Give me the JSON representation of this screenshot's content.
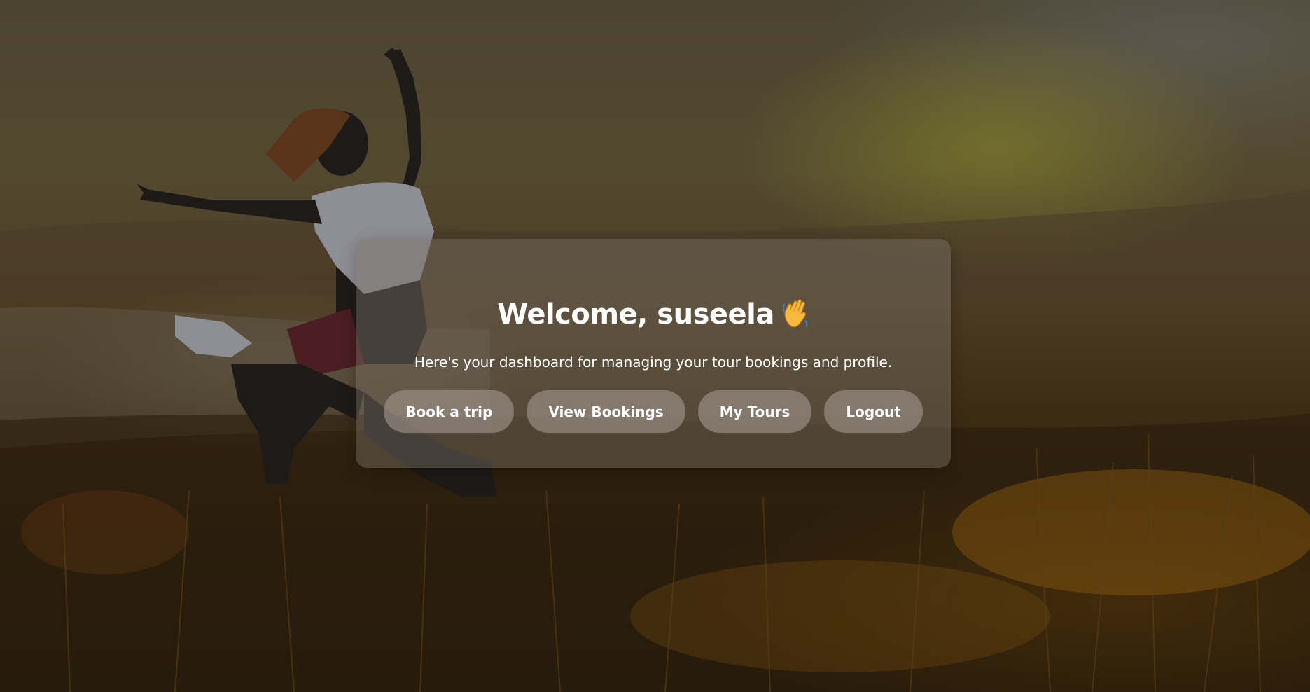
{
  "hero": {
    "background_description": "jumping-woman-at-sunset",
    "accent_colors": [
      "#4b4431",
      "#8c8c28",
      "#965f0a",
      "#241a0c"
    ]
  },
  "welcome": {
    "title": "Welcome, suseela",
    "wave_icon": "waving-hand-icon",
    "subtitle": "Here's your dashboard for managing your tour bookings and profile."
  },
  "actions": {
    "book_trip": "Book a trip",
    "view_bookings": "View Bookings",
    "my_tours": "My Tours",
    "logout": "Logout"
  }
}
